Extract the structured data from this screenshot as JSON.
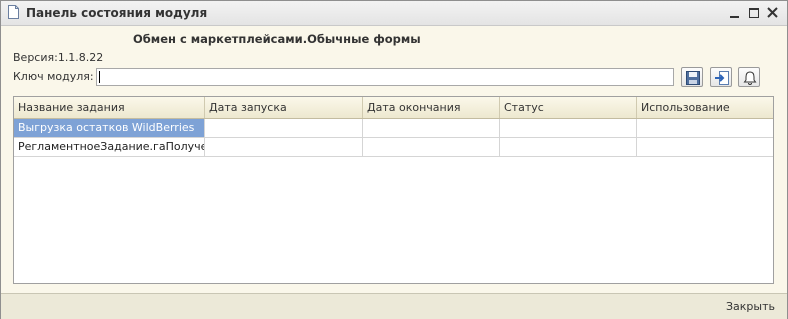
{
  "window": {
    "title": "Панель состояния модуля"
  },
  "form": {
    "heading": "Обмен с маркетплейсами.Обычные формы",
    "version": "Версия:1.1.8.22",
    "key_label": "Ключ модуля:",
    "key_value": ""
  },
  "toolbar": {
    "icons": [
      "save-icon",
      "import-icon",
      "bell-icon"
    ]
  },
  "table": {
    "columns": [
      "Название задания",
      "Дата запуска",
      "Дата окончания",
      "Статус",
      "Использование"
    ],
    "rows": [
      {
        "name": "Выгрузка остатков WildBerries",
        "start": "",
        "end": "",
        "status": "",
        "usage": ""
      },
      {
        "name": "РегламентноеЗадание.гаПолучен...",
        "start": "",
        "end": "",
        "status": "",
        "usage": ""
      }
    ],
    "selected_row": 0
  },
  "footer": {
    "close_label": "Закрыть"
  },
  "colors": {
    "selection": "#7ea2d6",
    "window_bg": "#faf7ea",
    "header_bg": "#ede8cf"
  }
}
